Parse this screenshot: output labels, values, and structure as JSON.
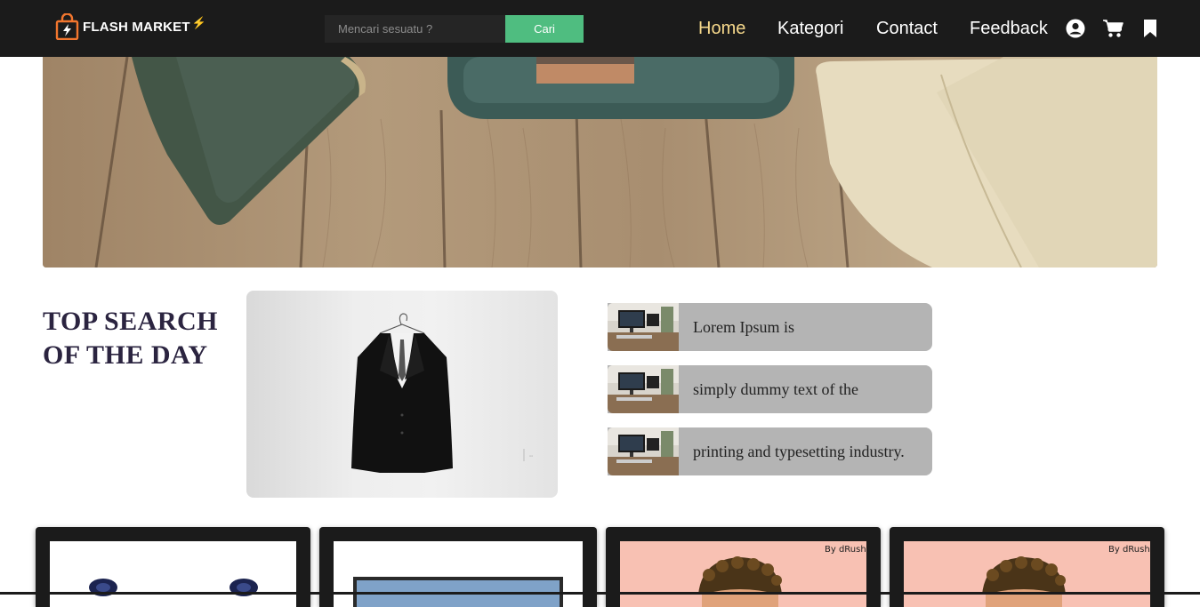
{
  "navbar": {
    "brand": "FLASH MARKET",
    "brand_bolt": "⚡",
    "search_placeholder": "Mencari sesuatu ?",
    "search_button": "Cari",
    "links": [
      "Home",
      "Kategori",
      "Contact",
      "Feedback"
    ],
    "active_link": "Home",
    "icons": [
      "user-circle-icon",
      "cart-icon",
      "bookmark-icon"
    ]
  },
  "top_search": {
    "title": "TOP SEARCH OF THE DAY",
    "items": [
      {
        "label": "Lorem Ipsum is"
      },
      {
        "label": "simply dummy text of the"
      },
      {
        "label": "printing and typesetting industry."
      }
    ]
  },
  "products": [
    {
      "image": "speakers"
    },
    {
      "image": "monitor"
    },
    {
      "image": "avatar-cartoon"
    },
    {
      "image": "avatar-cartoon"
    }
  ],
  "colors": {
    "navbar_bg": "#1b1b1b",
    "accent_green": "#4fbd80",
    "active_link": "#f6d88b",
    "brand_orange": "#f2762e",
    "title_color": "#2b2440",
    "item_bg": "#b4b4b4"
  }
}
